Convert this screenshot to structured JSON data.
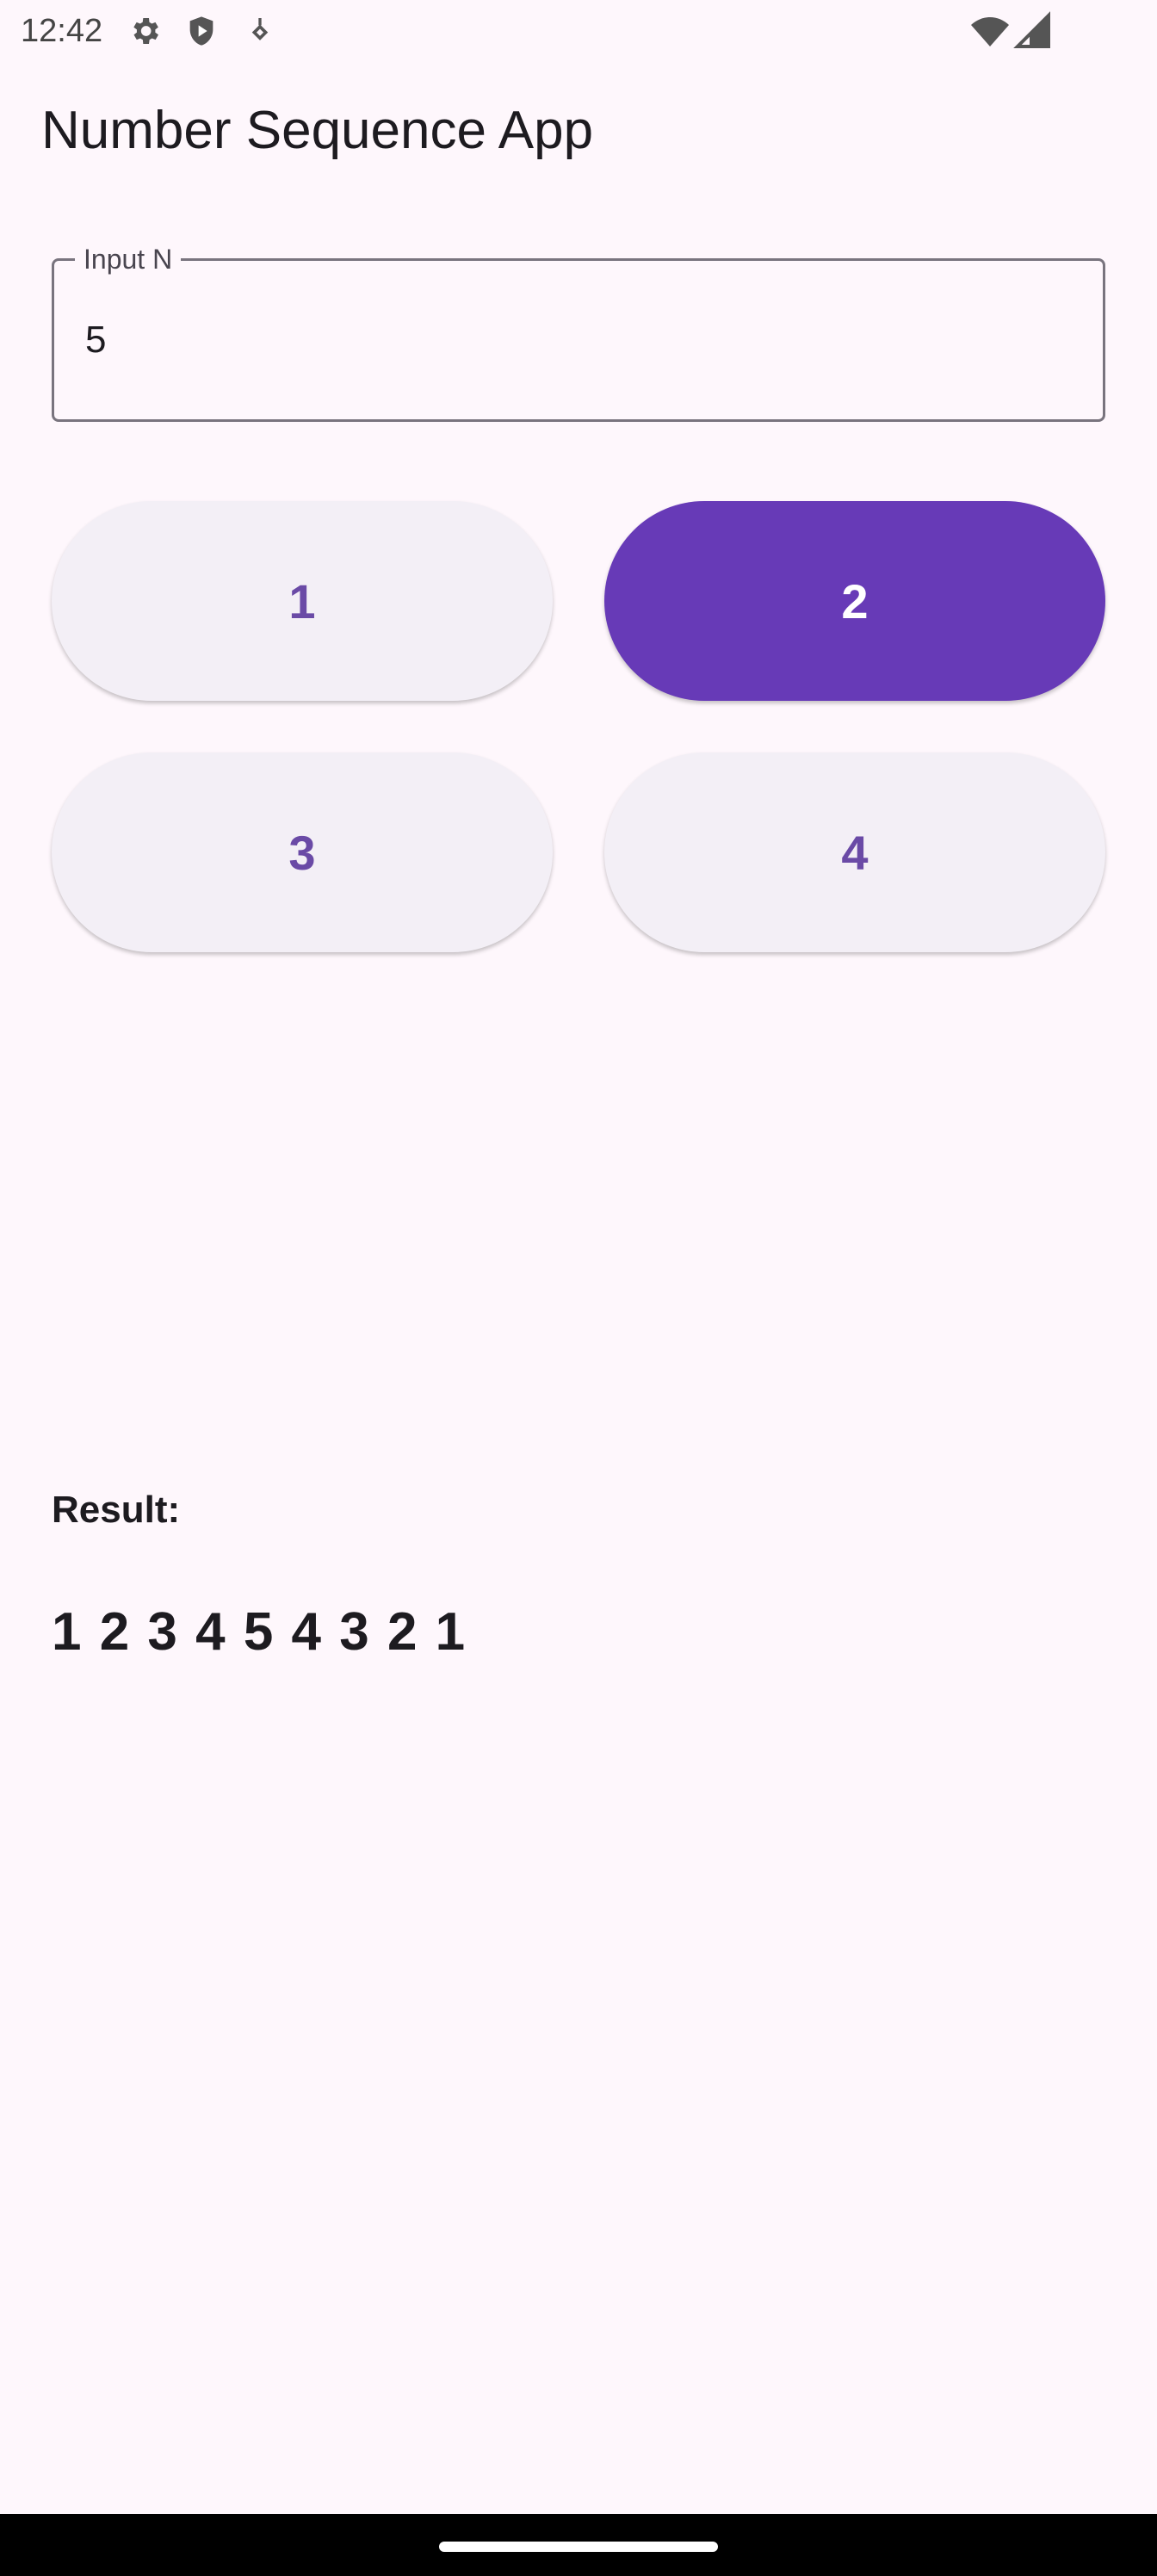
{
  "status_bar": {
    "time": "12:42",
    "icons_left": [
      "gear-icon",
      "shield-play-icon",
      "notification-diamond-icon"
    ],
    "icons_right": [
      "wifi-icon",
      "cellular-signal-icon"
    ]
  },
  "app_bar": {
    "title": "Number Sequence App"
  },
  "input": {
    "label": "Input N",
    "value": "5"
  },
  "buttons": [
    {
      "label": "1",
      "selected": false
    },
    {
      "label": "2",
      "selected": true
    },
    {
      "label": "3",
      "selected": false
    },
    {
      "label": "4",
      "selected": false
    }
  ],
  "result": {
    "label": "Result:",
    "value": "1 2 3 4 5 4 3 2 1"
  },
  "colors": {
    "background": "#fef7fc",
    "primary": "#673ab7",
    "button_surface": "#f3eff6",
    "button_text": "#6a4aa6"
  }
}
